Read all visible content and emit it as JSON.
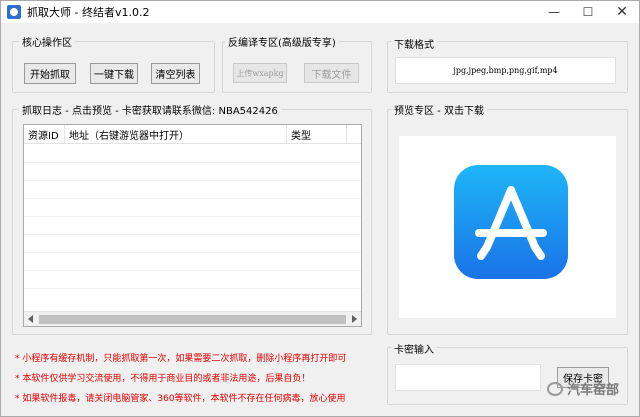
{
  "window": {
    "title": "抓取大师 - 终结者v1.0.2",
    "minimize": "—",
    "maximize": "☐",
    "close": "✕"
  },
  "core": {
    "label": "核心操作区",
    "start_btn": "开始抓取",
    "download_btn": "一键下载",
    "clear_btn": "清空列表"
  },
  "decompile": {
    "label": "反编译专区(高级版专享)",
    "upload_btn": "上传wxapkg",
    "download_btn": "下载文件"
  },
  "format": {
    "label": "下载格式",
    "value": "jpg,jpeg,bmp,png,gif,mp4"
  },
  "log": {
    "label": "抓取日志 - 点击预览 - 卡密获取请联系微信: NBA542426",
    "columns": [
      "资源ID",
      "地址（右键游览器中打开）",
      "类型"
    ]
  },
  "preview": {
    "label": "预览专区 - 双击下载",
    "icon": "app-store-icon"
  },
  "card": {
    "label": "卡密输入",
    "input_value": "",
    "save_btn": "保存卡密"
  },
  "notices": [
    "* 小程序有缓存机制，只能抓取第一次，如果需要二次抓取，删除小程序再打开即可",
    "* 本软件仅供学习交流使用，不得用于商业目的或者非法用途，后果自负！",
    "* 如果软件报毒，请关闭电脑管家、360等软件，本软件不存在任何病毒，放心使用"
  ],
  "watermark": "汽车窑部",
  "colors": {
    "notice": "#e00000",
    "appstore_top": "#1eb6f7",
    "appstore_bottom": "#1a73e8"
  }
}
